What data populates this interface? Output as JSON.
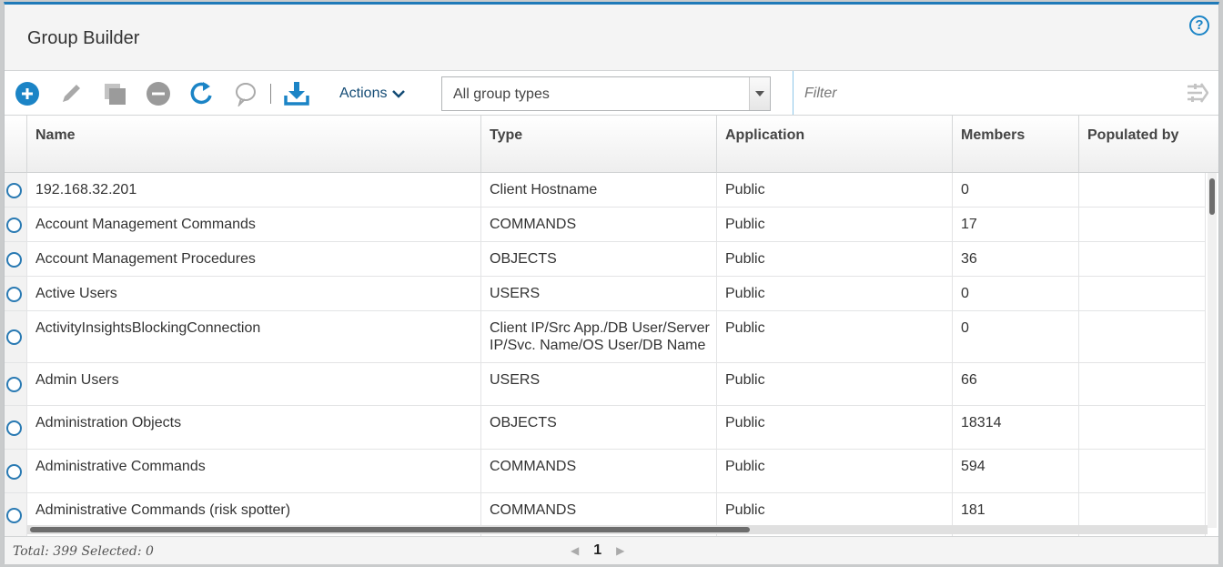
{
  "app": {
    "title": "Group Builder"
  },
  "toolbar": {
    "actions_label": "Actions",
    "group_type_select": "All group types",
    "filter_placeholder": "Filter",
    "icons": [
      "add-icon",
      "edit-icon",
      "copy-icon",
      "remove-icon",
      "refresh-icon",
      "comment-icon",
      "download-icon"
    ]
  },
  "columns": [
    "Name",
    "Type",
    "Application",
    "Members",
    "Populated by"
  ],
  "rows": [
    {
      "name": "192.168.32.201",
      "type": [
        "Client Hostname"
      ],
      "application": "Public",
      "members": "0"
    },
    {
      "name": "Account Management Commands",
      "type": [
        "COMMANDS"
      ],
      "application": "Public",
      "members": "17"
    },
    {
      "name": "Account Management Procedures",
      "type": [
        "OBJECTS"
      ],
      "application": "Public",
      "members": "36"
    },
    {
      "name": "Active Users",
      "type": [
        "USERS"
      ],
      "application": "Public",
      "members": "0"
    },
    {
      "name": "ActivityInsightsBlockingConnection",
      "type": [
        "Client IP/Src App./DB User/Server",
        "IP/Svc. Name/OS User/DB Name"
      ],
      "application": "Public",
      "members": "0"
    },
    {
      "name": "Admin Users",
      "type": [
        "USERS"
      ],
      "application": "Public",
      "members": "66"
    },
    {
      "name": "Administration Objects",
      "type": [
        "OBJECTS"
      ],
      "application": "Public",
      "members": "18314"
    },
    {
      "name": "Administrative Commands",
      "type": [
        "COMMANDS"
      ],
      "application": "Public",
      "members": "594"
    },
    {
      "name": "Administrative Commands (risk spotter)",
      "type": [
        "COMMANDS"
      ],
      "application": "Public",
      "members": "181"
    }
  ],
  "footer": {
    "status": "Total: 399 Selected: 0",
    "page": "1"
  },
  "colors": {
    "accent": "#1b84c6",
    "header_bar": "#1f7ab8"
  }
}
